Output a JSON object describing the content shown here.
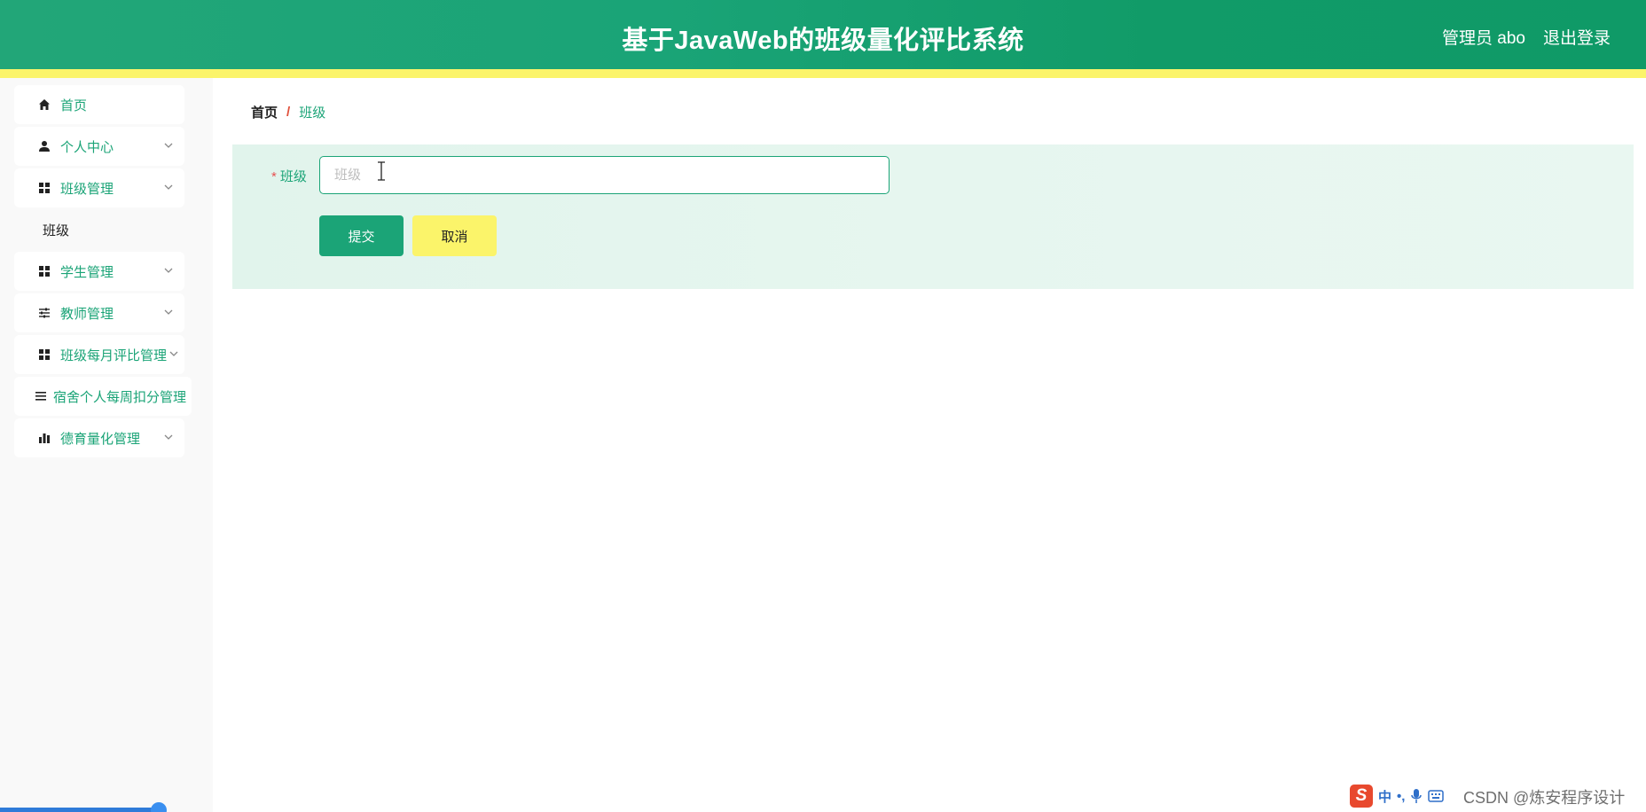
{
  "header": {
    "title": "基于JavaWeb的班级量化评比系统",
    "user": "管理员 abo",
    "logout": "退出登录"
  },
  "sidebar": {
    "items": [
      {
        "label": "首页",
        "icon": "home-icon"
      },
      {
        "label": "个人中心",
        "icon": "user-icon"
      },
      {
        "label": "班级管理",
        "icon": "grid-icon"
      },
      {
        "label": "班级"
      },
      {
        "label": "学生管理",
        "icon": "grid-icon"
      },
      {
        "label": "教师管理",
        "icon": "sliders-icon"
      },
      {
        "label": "班级每月评比管理",
        "icon": "grid-icon"
      },
      {
        "label": "宿舍个人每周扣分管理",
        "icon": "list-icon"
      },
      {
        "label": "德育量化管理",
        "icon": "bar-chart-icon"
      }
    ]
  },
  "breadcrumb": {
    "home": "首页",
    "separator": "/",
    "current": "班级"
  },
  "form": {
    "required_mark": "*",
    "field_label": "班级",
    "field_placeholder": "班级",
    "field_value": "",
    "submit": "提交",
    "cancel": "取消"
  },
  "ime": {
    "logo": "S",
    "mode": "中"
  },
  "watermark": "CSDN @炼安程序设计",
  "colors": {
    "primary": "#1ba477",
    "accent_yellow": "#fbf46a",
    "required_red": "#e65151"
  }
}
